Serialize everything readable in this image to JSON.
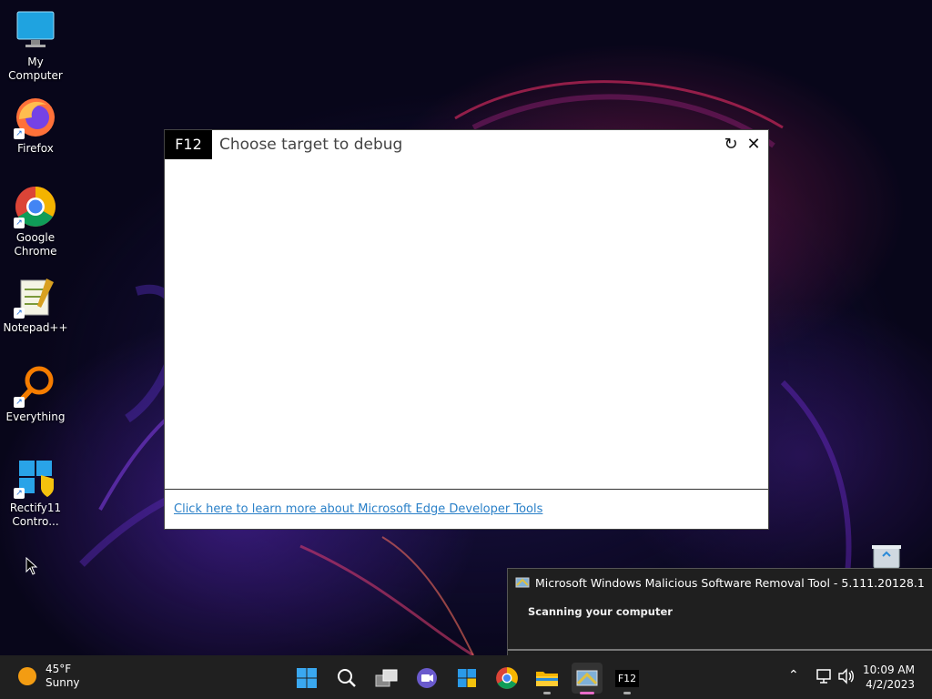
{
  "desktop": {
    "icons": [
      {
        "label": "My Computer"
      },
      {
        "label": "Firefox"
      },
      {
        "label": "Google Chrome"
      },
      {
        "label": "Notepad++"
      },
      {
        "label": "Everything"
      },
      {
        "label": "Rectify11 Contro..."
      }
    ]
  },
  "debugger": {
    "badge": "F12",
    "title": "Choose target to debug",
    "link": "Click here to learn more about Microsoft Edge Developer Tools"
  },
  "notification": {
    "title": "Microsoft Windows Malicious Software Removal Tool - 5.111.20128.1",
    "message": "Scanning your computer"
  },
  "taskbar": {
    "weather": {
      "temp": "45°F",
      "condition": "Sunny"
    },
    "f12_label": "F12",
    "clock": {
      "time": "10:09 AM",
      "date": "4/2/2023"
    }
  },
  "colors": {
    "accent": "#2a80c8",
    "taskbar": "#202020",
    "active_indicator": "#e86cc8"
  }
}
